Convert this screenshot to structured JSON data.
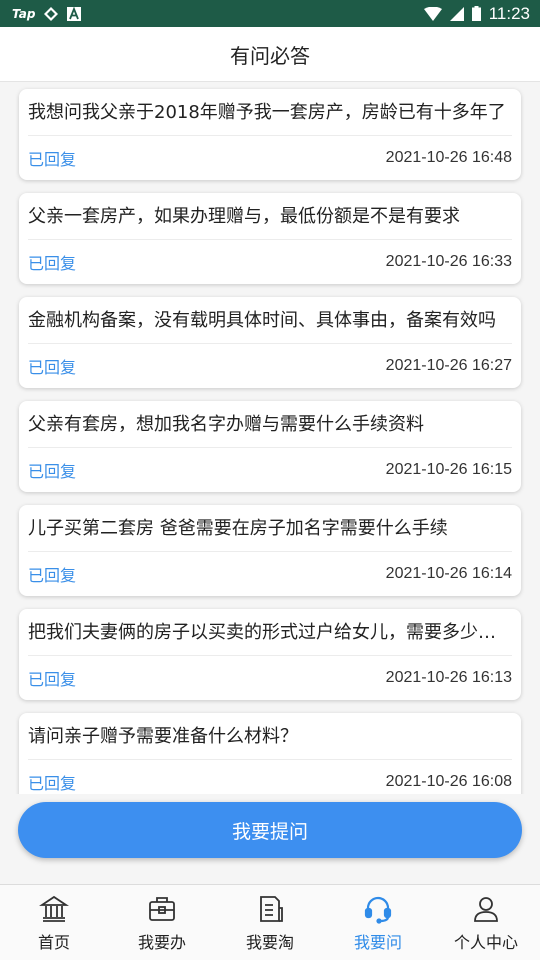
{
  "status_bar": {
    "carrier": "Tap",
    "time": "11:23"
  },
  "header": {
    "title": "有问必答"
  },
  "questions": [
    {
      "text": "我想问我父亲于2018年赠予我一套房产，房龄已有十多年了",
      "status": "已回复",
      "time": "2021-10-26 16:48"
    },
    {
      "text": "父亲一套房产，如果办理赠与，最低份额是不是有要求",
      "status": "已回复",
      "time": "2021-10-26 16:33"
    },
    {
      "text": "金融机构备案，没有载明具体时间、具体事由，备案有效吗",
      "status": "已回复",
      "time": "2021-10-26 16:27"
    },
    {
      "text": "父亲有套房，想加我名字办赠与需要什么手续资料",
      "status": "已回复",
      "time": "2021-10-26 16:15"
    },
    {
      "text": "儿子买第二套房 爸爸需要在房子加名字需要什么手续",
      "status": "已回复",
      "time": "2021-10-26 16:14"
    },
    {
      "text": "把我们夫妻俩的房子以买卖的形式过户给女儿，需要多少税费",
      "status": "已回复",
      "time": "2021-10-26 16:13"
    },
    {
      "text": "请问亲子赠予需要准备什么材料？",
      "status": "已回复",
      "time": "2021-10-26 16:08"
    }
  ],
  "ask_button": {
    "label": "我要提问"
  },
  "tabs": [
    {
      "label": "首页",
      "icon": "bank-icon"
    },
    {
      "label": "我要办",
      "icon": "briefcase-icon"
    },
    {
      "label": "我要淘",
      "icon": "document-icon"
    },
    {
      "label": "我要问",
      "icon": "headset-icon",
      "active": true
    },
    {
      "label": "个人中心",
      "icon": "person-icon"
    }
  ],
  "colors": {
    "status_bar": "#1e5b47",
    "accent": "#3d8ff0",
    "reply_status": "#3a8fe8"
  }
}
